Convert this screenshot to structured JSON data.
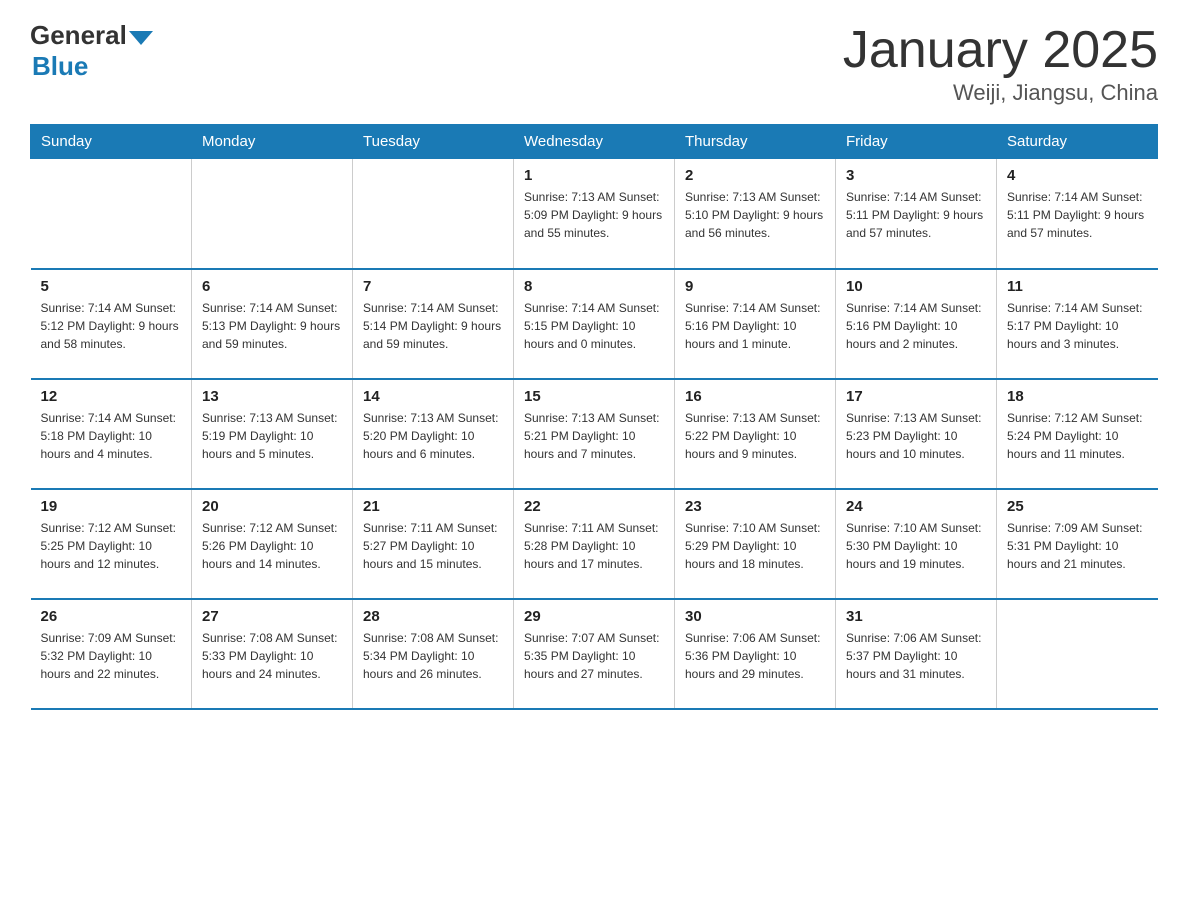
{
  "header": {
    "logo_general": "General",
    "logo_blue": "Blue",
    "title": "January 2025",
    "subtitle": "Weiji, Jiangsu, China"
  },
  "days_of_week": [
    "Sunday",
    "Monday",
    "Tuesday",
    "Wednesday",
    "Thursday",
    "Friday",
    "Saturday"
  ],
  "weeks": [
    [
      {
        "day": "",
        "info": ""
      },
      {
        "day": "",
        "info": ""
      },
      {
        "day": "",
        "info": ""
      },
      {
        "day": "1",
        "info": "Sunrise: 7:13 AM\nSunset: 5:09 PM\nDaylight: 9 hours and 55 minutes."
      },
      {
        "day": "2",
        "info": "Sunrise: 7:13 AM\nSunset: 5:10 PM\nDaylight: 9 hours and 56 minutes."
      },
      {
        "day": "3",
        "info": "Sunrise: 7:14 AM\nSunset: 5:11 PM\nDaylight: 9 hours and 57 minutes."
      },
      {
        "day": "4",
        "info": "Sunrise: 7:14 AM\nSunset: 5:11 PM\nDaylight: 9 hours and 57 minutes."
      }
    ],
    [
      {
        "day": "5",
        "info": "Sunrise: 7:14 AM\nSunset: 5:12 PM\nDaylight: 9 hours and 58 minutes."
      },
      {
        "day": "6",
        "info": "Sunrise: 7:14 AM\nSunset: 5:13 PM\nDaylight: 9 hours and 59 minutes."
      },
      {
        "day": "7",
        "info": "Sunrise: 7:14 AM\nSunset: 5:14 PM\nDaylight: 9 hours and 59 minutes."
      },
      {
        "day": "8",
        "info": "Sunrise: 7:14 AM\nSunset: 5:15 PM\nDaylight: 10 hours and 0 minutes."
      },
      {
        "day": "9",
        "info": "Sunrise: 7:14 AM\nSunset: 5:16 PM\nDaylight: 10 hours and 1 minute."
      },
      {
        "day": "10",
        "info": "Sunrise: 7:14 AM\nSunset: 5:16 PM\nDaylight: 10 hours and 2 minutes."
      },
      {
        "day": "11",
        "info": "Sunrise: 7:14 AM\nSunset: 5:17 PM\nDaylight: 10 hours and 3 minutes."
      }
    ],
    [
      {
        "day": "12",
        "info": "Sunrise: 7:14 AM\nSunset: 5:18 PM\nDaylight: 10 hours and 4 minutes."
      },
      {
        "day": "13",
        "info": "Sunrise: 7:13 AM\nSunset: 5:19 PM\nDaylight: 10 hours and 5 minutes."
      },
      {
        "day": "14",
        "info": "Sunrise: 7:13 AM\nSunset: 5:20 PM\nDaylight: 10 hours and 6 minutes."
      },
      {
        "day": "15",
        "info": "Sunrise: 7:13 AM\nSunset: 5:21 PM\nDaylight: 10 hours and 7 minutes."
      },
      {
        "day": "16",
        "info": "Sunrise: 7:13 AM\nSunset: 5:22 PM\nDaylight: 10 hours and 9 minutes."
      },
      {
        "day": "17",
        "info": "Sunrise: 7:13 AM\nSunset: 5:23 PM\nDaylight: 10 hours and 10 minutes."
      },
      {
        "day": "18",
        "info": "Sunrise: 7:12 AM\nSunset: 5:24 PM\nDaylight: 10 hours and 11 minutes."
      }
    ],
    [
      {
        "day": "19",
        "info": "Sunrise: 7:12 AM\nSunset: 5:25 PM\nDaylight: 10 hours and 12 minutes."
      },
      {
        "day": "20",
        "info": "Sunrise: 7:12 AM\nSunset: 5:26 PM\nDaylight: 10 hours and 14 minutes."
      },
      {
        "day": "21",
        "info": "Sunrise: 7:11 AM\nSunset: 5:27 PM\nDaylight: 10 hours and 15 minutes."
      },
      {
        "day": "22",
        "info": "Sunrise: 7:11 AM\nSunset: 5:28 PM\nDaylight: 10 hours and 17 minutes."
      },
      {
        "day": "23",
        "info": "Sunrise: 7:10 AM\nSunset: 5:29 PM\nDaylight: 10 hours and 18 minutes."
      },
      {
        "day": "24",
        "info": "Sunrise: 7:10 AM\nSunset: 5:30 PM\nDaylight: 10 hours and 19 minutes."
      },
      {
        "day": "25",
        "info": "Sunrise: 7:09 AM\nSunset: 5:31 PM\nDaylight: 10 hours and 21 minutes."
      }
    ],
    [
      {
        "day": "26",
        "info": "Sunrise: 7:09 AM\nSunset: 5:32 PM\nDaylight: 10 hours and 22 minutes."
      },
      {
        "day": "27",
        "info": "Sunrise: 7:08 AM\nSunset: 5:33 PM\nDaylight: 10 hours and 24 minutes."
      },
      {
        "day": "28",
        "info": "Sunrise: 7:08 AM\nSunset: 5:34 PM\nDaylight: 10 hours and 26 minutes."
      },
      {
        "day": "29",
        "info": "Sunrise: 7:07 AM\nSunset: 5:35 PM\nDaylight: 10 hours and 27 minutes."
      },
      {
        "day": "30",
        "info": "Sunrise: 7:06 AM\nSunset: 5:36 PM\nDaylight: 10 hours and 29 minutes."
      },
      {
        "day": "31",
        "info": "Sunrise: 7:06 AM\nSunset: 5:37 PM\nDaylight: 10 hours and 31 minutes."
      },
      {
        "day": "",
        "info": ""
      }
    ]
  ]
}
